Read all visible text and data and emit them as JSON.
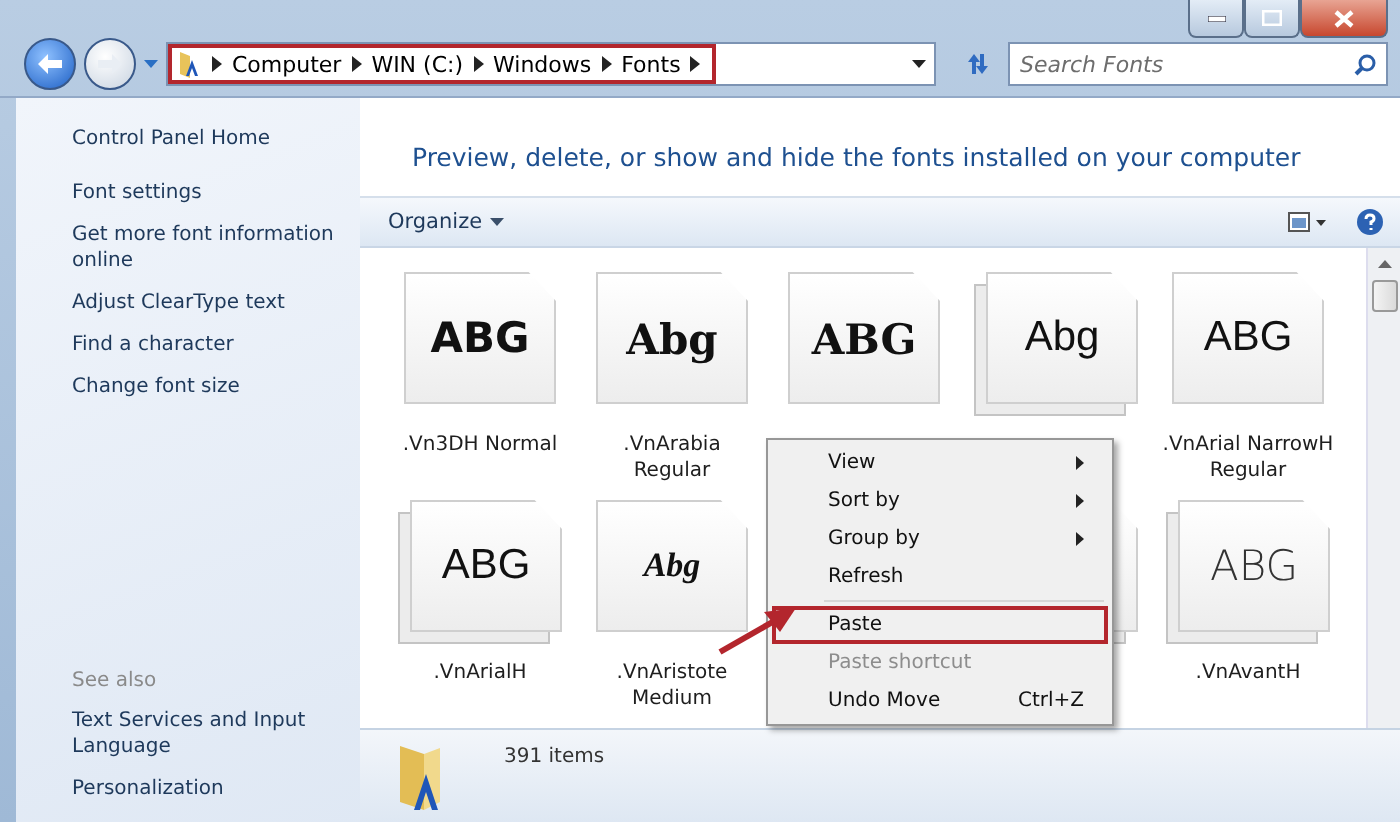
{
  "address_bar": {
    "highlighted": true,
    "path": [
      "Computer",
      "WIN (C:)",
      "Windows",
      "Fonts"
    ]
  },
  "search": {
    "placeholder": "Search Fonts"
  },
  "sidebar": {
    "items": [
      "Control Panel Home",
      "Font settings",
      "Get more font information online",
      "Adjust ClearType text",
      "Find a character",
      "Change font size"
    ],
    "see_also_title": "See also",
    "see_also": [
      "Text Services and Input Language",
      "Personalization"
    ]
  },
  "header": "Preview, delete, or show and hide the fonts installed on your computer",
  "toolbar": {
    "organize": "Organize"
  },
  "fonts": [
    {
      "sample": "ABG",
      "kind": "stencil",
      "stacked": false,
      "label": ".Vn3DH  Normal"
    },
    {
      "sample": "Abg",
      "kind": "blackletter",
      "stacked": false,
      "label": ".VnArabia Regular"
    },
    {
      "sample": "ABG",
      "kind": "blackletter",
      "stacked": false
    },
    {
      "sample": "Abg",
      "kind": "sans",
      "stacked": true
    },
    {
      "sample": "ABG",
      "kind": "sans",
      "stacked": false,
      "label": ".VnArial NarrowH Regular"
    },
    {
      "sample": "ABG",
      "kind": "sans",
      "stacked": true,
      "label": ".VnArialH"
    },
    {
      "sample": "Abg",
      "kind": "script",
      "stacked": false,
      "label": ".VnAristote Medium"
    },
    {
      "stacked": true
    },
    {
      "sample": "ABG",
      "kind": "thin",
      "stacked": true,
      "label": ".VnAvantH"
    }
  ],
  "context_menu": [
    {
      "label": "View",
      "submenu": true,
      "disabled": false,
      "highlighted": false
    },
    {
      "label": "Sort by",
      "submenu": true,
      "disabled": false,
      "highlighted": false
    },
    {
      "label": "Group by",
      "submenu": true,
      "disabled": false,
      "highlighted": false
    },
    {
      "label": "Refresh",
      "submenu": false,
      "disabled": false,
      "highlighted": false,
      "separator_after": true
    },
    {
      "label": "Paste",
      "submenu": false,
      "disabled": false,
      "highlighted": true
    },
    {
      "label": "Paste shortcut",
      "submenu": false,
      "disabled": true,
      "highlighted": false
    },
    {
      "label": "Undo Move",
      "shortcut": "Ctrl+Z",
      "submenu": false,
      "disabled": false,
      "highlighted": false
    }
  ],
  "status_bar": {
    "count": "391 items"
  }
}
